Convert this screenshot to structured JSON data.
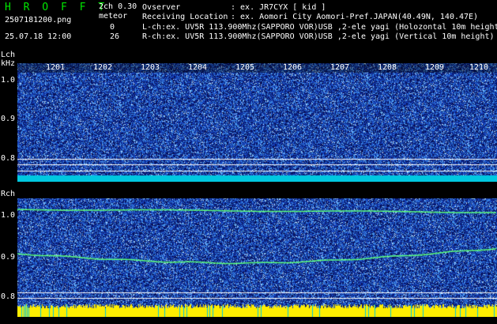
{
  "header": {
    "app_title": "H R O F F T",
    "mode": "2ch 0.30",
    "filename": "2507181200.png",
    "meteor_label": "meteor",
    "meteor_lch_count": "0",
    "meteor_rch_count": "26",
    "datetime": "25.07.18 12:00",
    "observer_label": "Ovserver",
    "observer_value": ": ex. JR7CYX [ kid ]",
    "location_label": "Receiving Location",
    "location_value": ": ex. Aomori City Aomori-Pref.JAPAN(40.49N, 140.47E)",
    "lch_info": "L-ch:ex. UV5R 113.900Mhz(SAPPORO VOR)USB ,2-ele yagi (Holozontal 10m height)",
    "rch_info": "R-ch:ex. UV5R 113.900Mhz(SAPPORO VOR)USB ,2-ele yagi (Vertical 10m height)"
  },
  "lch_panel": {
    "label": "Lch",
    "unit": "kHz",
    "yticks": [
      "1.0",
      "0.9",
      "0.8"
    ],
    "time_labels": [
      "1201",
      "1202",
      "1203",
      "1204",
      "1205",
      "1206",
      "1207",
      "1208",
      "1209",
      "1210"
    ],
    "colors": {
      "noise_dark": "#0a1a6e",
      "noise_mid": "#1e5ad0",
      "bar": "#00c8e0",
      "line": "#ffffff"
    }
  },
  "rch_panel": {
    "label": "Rch",
    "yticks": [
      "1.0",
      "0.9",
      "0.8"
    ],
    "colors": {
      "noise_dark": "#0a1a6e",
      "noise_mid": "#1e5ad0",
      "trace": "#5cff7a",
      "bar": "#ffee00",
      "bar_alt": "#00c8e0",
      "line": "#ffffff"
    }
  }
}
